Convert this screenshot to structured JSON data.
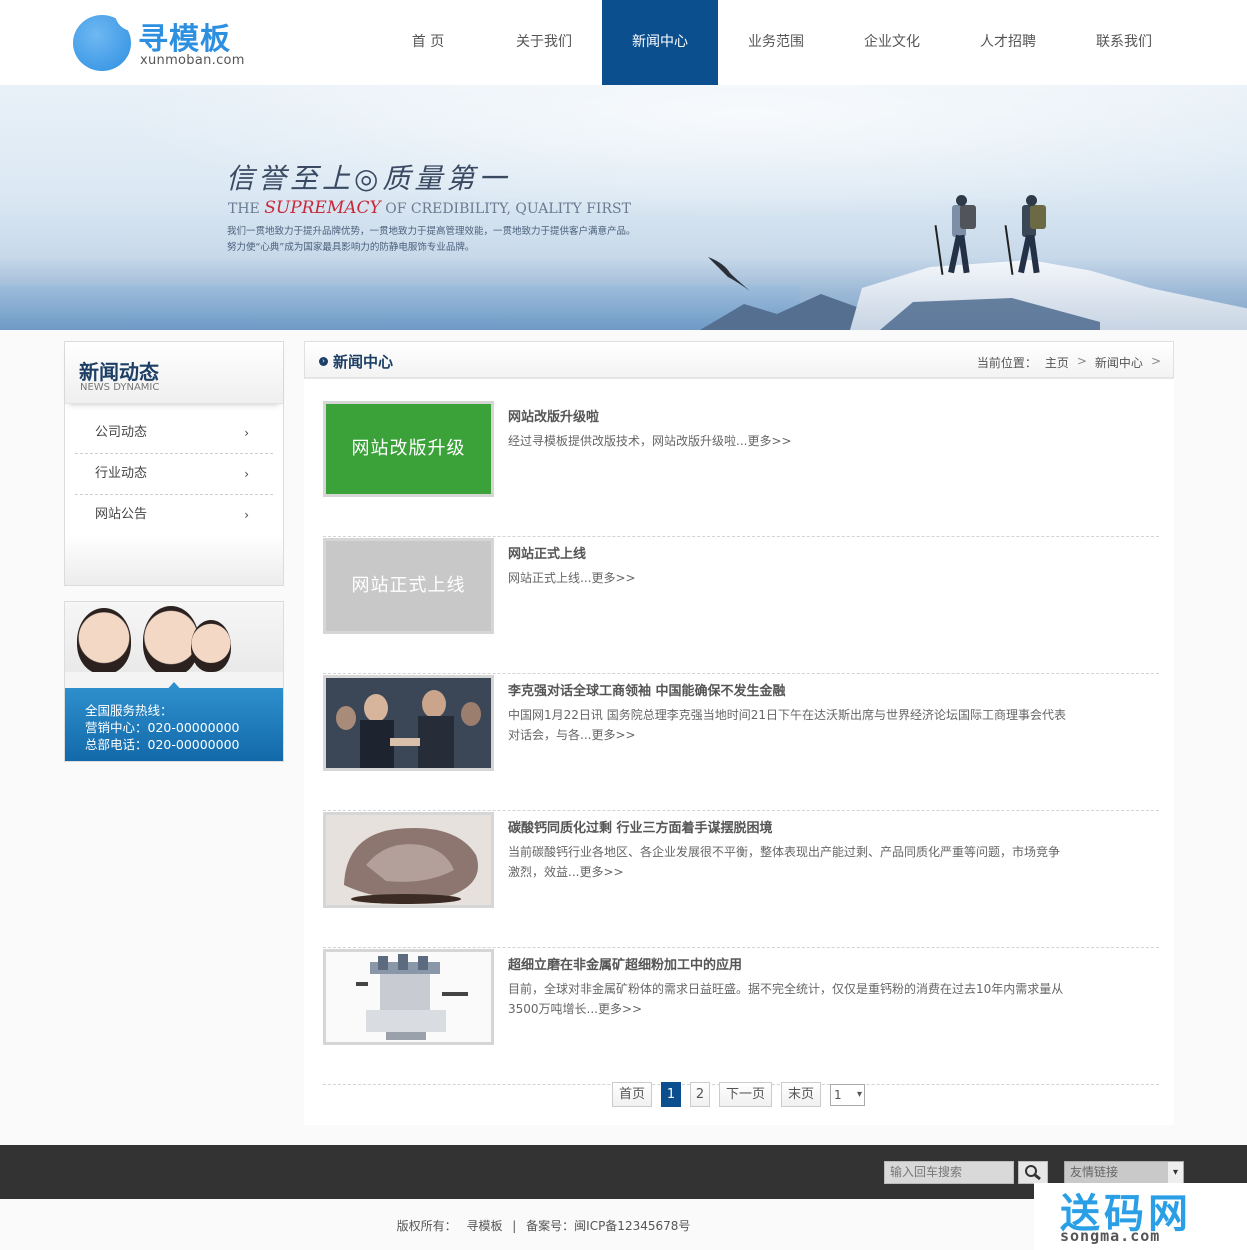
{
  "logo": {
    "name_cn": "寻模板",
    "domain": "xunmoban.com"
  },
  "nav": [
    {
      "label": "首  页"
    },
    {
      "label": "关于我们"
    },
    {
      "label": "新闻中心",
      "active": true
    },
    {
      "label": "业务范围"
    },
    {
      "label": "企业文化"
    },
    {
      "label": "人才招聘"
    },
    {
      "label": "联系我们"
    }
  ],
  "banner": {
    "slogan_cn": "信誉至上◎质量第一",
    "slogan_en_pre": "THE ",
    "slogan_en_highlight": "SUPREMACY",
    "slogan_en_post": " OF CREDIBILITY, QUALITY FIRST",
    "desc_line1": "我们一贯地致力于提升品牌优势，一贯地致力于提高管理效能，一贯地致力于提供客户满意产品。",
    "desc_line2": "努力使“心典”成为国家最具影响力的防静电服饰专业品牌。"
  },
  "sidebar": {
    "title": "新闻动态",
    "subtitle": "NEWS DYNAMIC",
    "items": [
      {
        "label": "公司动态",
        "arrow": "›"
      },
      {
        "label": "行业动态",
        "arrow": "›"
      },
      {
        "label": "网站公告",
        "arrow": "›"
      }
    ]
  },
  "contact": {
    "hotline_label": "全国服务热线：",
    "sales": "营销中心：020-00000000",
    "hq": "总部电话：020-00000000"
  },
  "main": {
    "title": "新闻中心",
    "breadcrumb": {
      "prefix": "当前位置：",
      "home": "主页",
      "sep": ">",
      "current": "新闻中心"
    },
    "news": [
      {
        "thumb_text": "网站改版升级",
        "title": "网站改版升级啦",
        "summary": "经过寻模板提供改版技术，网站改版升级啦...更多>>"
      },
      {
        "thumb_text": "网站正式上线",
        "title": "网站正式上线",
        "summary": "网站正式上线...更多>>"
      },
      {
        "thumb_text": "",
        "title": "李克强对话全球工商领袖 中国能确保不发生金融",
        "summary": "中国网1月22日讯 国务院总理李克强当地时间21日下午在达沃斯出席与世界经济论坛国际工商理事会代表对话会，与各...更多>>"
      },
      {
        "thumb_text": "",
        "title": "碳酸钙同质化过剩 行业三方面着手谋摆脱困境",
        "summary": "当前碳酸钙行业各地区、各企业发展很不平衡，整体表现出产能过剩、产品同质化严重等问题，市场竞争激烈，效益...更多>>"
      },
      {
        "thumb_text": "",
        "title": "超细立磨在非金属矿超细粉加工中的应用",
        "summary": "目前，全球对非金属矿粉体的需求日益旺盛。据不完全统计，仅仅是重钙粉的消费在过去10年内需求量从3500万吨增长...更多>>"
      }
    ],
    "pager": {
      "first": "首页",
      "pages": [
        "1",
        "2"
      ],
      "current": "1",
      "next": "下一页",
      "last": "末页",
      "select_value": "1"
    }
  },
  "footer": {
    "search_placeholder": "输入回车搜索",
    "links_select": "友情链接",
    "copyright_label": "版权所有：",
    "copyright_owner": "寻模板",
    "divider": "|",
    "icp": "备案号：闽ICP备12345678号"
  },
  "watermark": {
    "cn": "送码网",
    "en": "songma.com"
  },
  "colors": {
    "nav_active": "#0c4f8f",
    "logo_blue": "#2d8fe0",
    "thumb_green": "#3ba23a",
    "contact_blue": "#1f7dbd"
  }
}
